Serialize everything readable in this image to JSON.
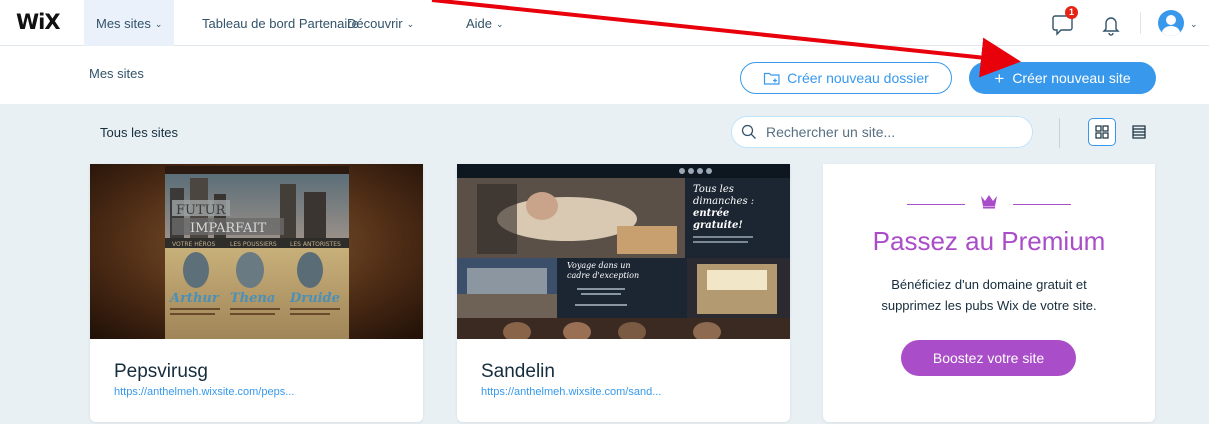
{
  "nav": {
    "logo": "WiX",
    "my_sites": "Mes sites",
    "partner_dashboard": "Tableau de bord Partenaire",
    "discover": "Découvrir",
    "help": "Aide",
    "notification_count": "1"
  },
  "subheader": {
    "title": "Mes sites",
    "new_folder_label": "Créer nouveau dossier",
    "new_site_label": "Créer nouveau site"
  },
  "toolbar": {
    "filter_label": "Tous les sites",
    "search_placeholder": "Rechercher un site..."
  },
  "sites": [
    {
      "name": "Pepsvirusg",
      "url": "https://anthelmeh.wixsite.com/peps...",
      "thumb_text": {
        "title1": "FUTUR",
        "title2": "IMPARFAIT",
        "nav1": "VOTRE HÉROS",
        "nav2": "LES POUSSIERS",
        "nav3": "LES ANTORISTES",
        "hero1": "Arthur",
        "hero2": "Thena",
        "hero3": "Druide"
      }
    },
    {
      "name": "Sandelin",
      "url": "https://anthelmeh.wixsite.com/sand...",
      "thumb_text": {
        "headline1": "Tous les",
        "headline2": "dimanches :",
        "headline3": "entrée",
        "headline4": "gratuite!",
        "voyage1": "Voyage dans un",
        "voyage2": "cadre d'exception"
      }
    }
  ],
  "premium": {
    "title": "Passez au Premium",
    "desc_line1": "Bénéficiez d'un domaine gratuit et",
    "desc_line2": "supprimez les pubs Wix de votre site.",
    "button_label": "Boostez votre site"
  },
  "colors": {
    "accent": "#3899ec",
    "premium": "#aa4dc8",
    "annotation": "#e8000b"
  }
}
